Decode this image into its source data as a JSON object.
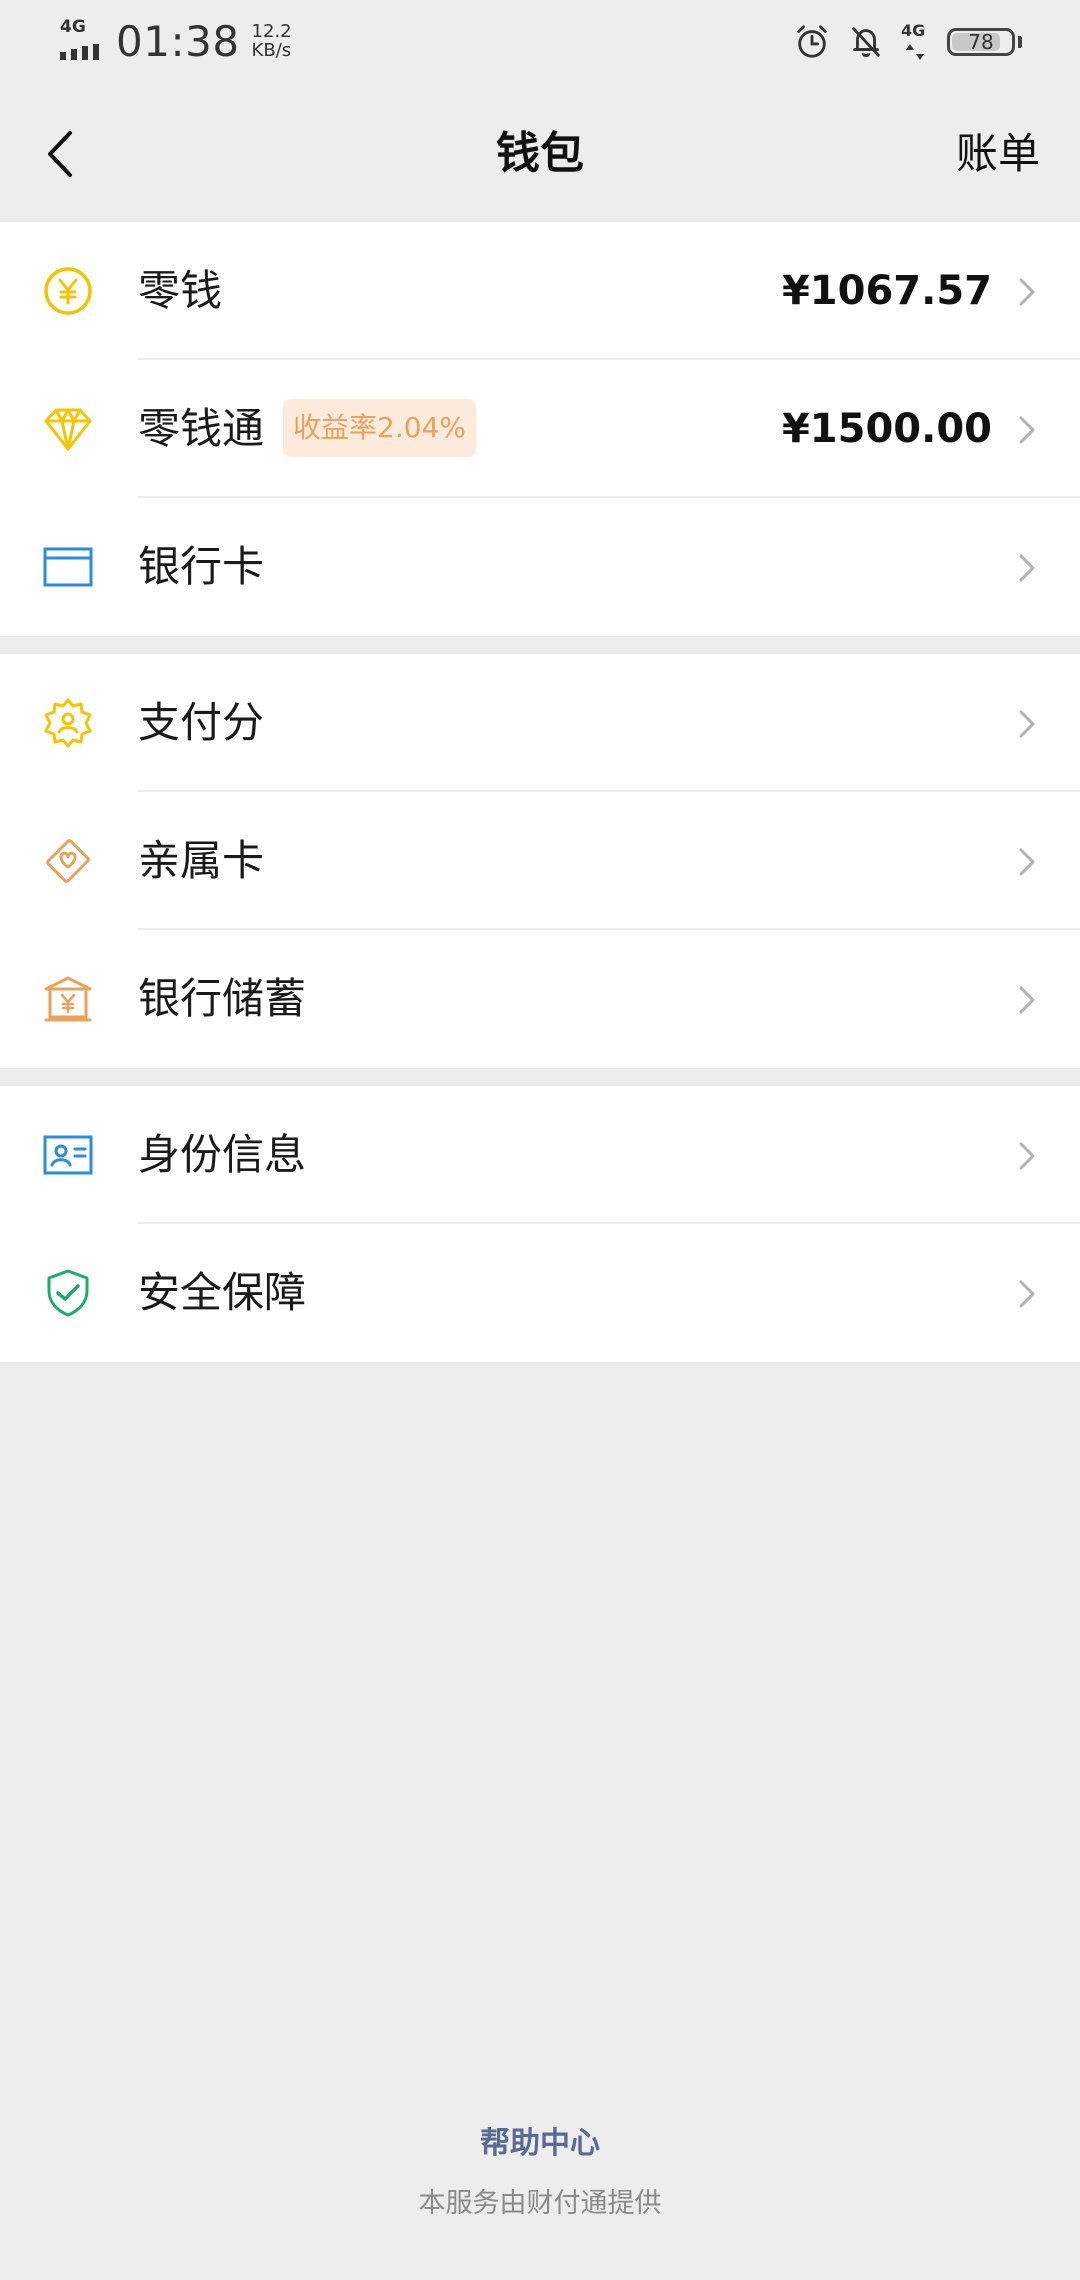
{
  "status_bar": {
    "network": "4G",
    "time": "01:38",
    "speed_value": "12.2",
    "speed_unit": "KB/s",
    "network2": "4G",
    "battery": "78",
    "icons": [
      "alarm-icon",
      "bell-off-icon"
    ]
  },
  "nav": {
    "title": "钱包",
    "right_label": "账单"
  },
  "groups": [
    {
      "items": [
        {
          "icon": "yuan-coin-icon",
          "label": "零钱",
          "value": "¥1067.57"
        },
        {
          "icon": "diamond-icon",
          "label": "零钱通",
          "badge": "收益率2.04%",
          "value": "¥1500.00"
        },
        {
          "icon": "bank-card-icon",
          "label": "银行卡"
        }
      ]
    },
    {
      "items": [
        {
          "icon": "pay-score-icon",
          "label": "支付分"
        },
        {
          "icon": "family-card-icon",
          "label": "亲属卡"
        },
        {
          "icon": "bank-savings-icon",
          "label": "银行储蓄"
        }
      ]
    },
    {
      "items": [
        {
          "icon": "id-card-icon",
          "label": "身份信息"
        },
        {
          "icon": "shield-check-icon",
          "label": "安全保障"
        }
      ]
    }
  ],
  "footer": {
    "help": "帮助中心",
    "note": "本服务由财付通提供"
  },
  "colors": {
    "yellow": "#f5c400",
    "orange": "#e8a25b",
    "blue": "#2b8ae2",
    "green": "#1aad6b",
    "link": "#576b95"
  }
}
